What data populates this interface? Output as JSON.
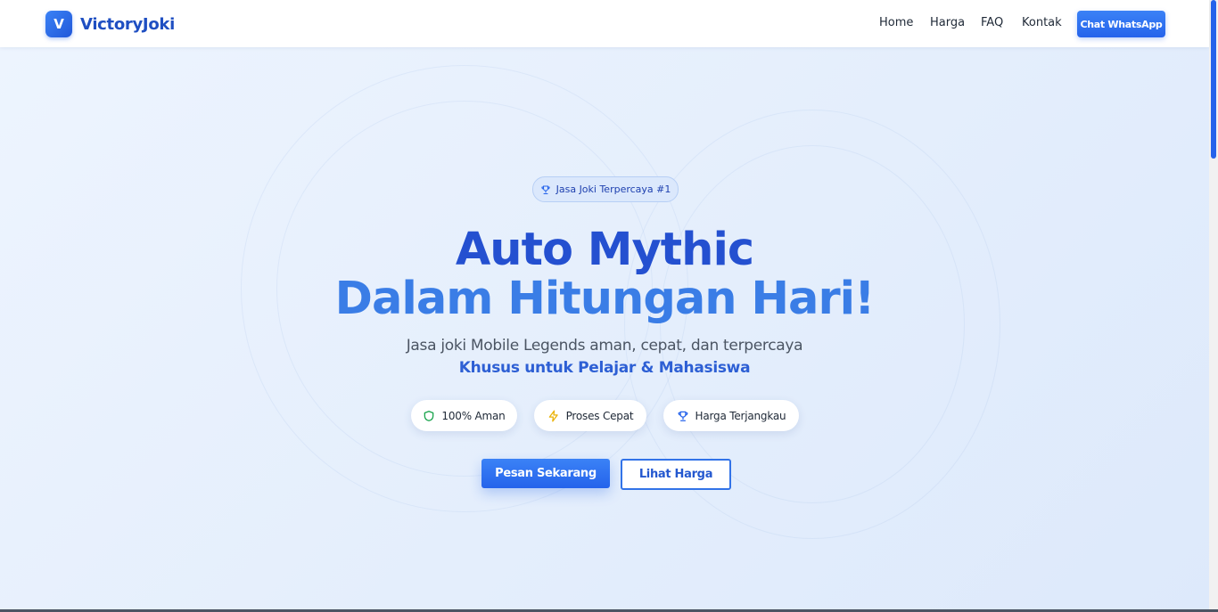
{
  "brand": {
    "logo_letter": "V",
    "name": "VictoryJoki",
    "accent": "#2563eb"
  },
  "nav": {
    "items": [
      {
        "label": "Home"
      },
      {
        "label": "Harga"
      },
      {
        "label": "FAQ"
      },
      {
        "label": "Kontak"
      }
    ],
    "cta_label": "Chat WhatsApp"
  },
  "hero": {
    "badge": {
      "icon": "trophy-icon",
      "text": "Jasa Joki Terpercaya #1"
    },
    "title_line1": "Auto Mythic",
    "title_line2": "Dalam Hitungan Hari!",
    "subtitle": "Jasa joki Mobile Legends aman, cepat, dan terpercaya",
    "subtitle_highlight": "Khusus untuk Pelajar & Mahasiswa",
    "features": [
      {
        "icon": "shield-icon",
        "label": "100% Aman",
        "color": "#16a34a"
      },
      {
        "icon": "lightning-icon",
        "label": "Proses Cepat",
        "color": "#eab308"
      },
      {
        "icon": "trophy-icon",
        "label": "Harga Terjangkau",
        "color": "#2563eb"
      }
    ],
    "primary_button": "Pesan Sekarang",
    "secondary_button": "Lihat Harga"
  }
}
